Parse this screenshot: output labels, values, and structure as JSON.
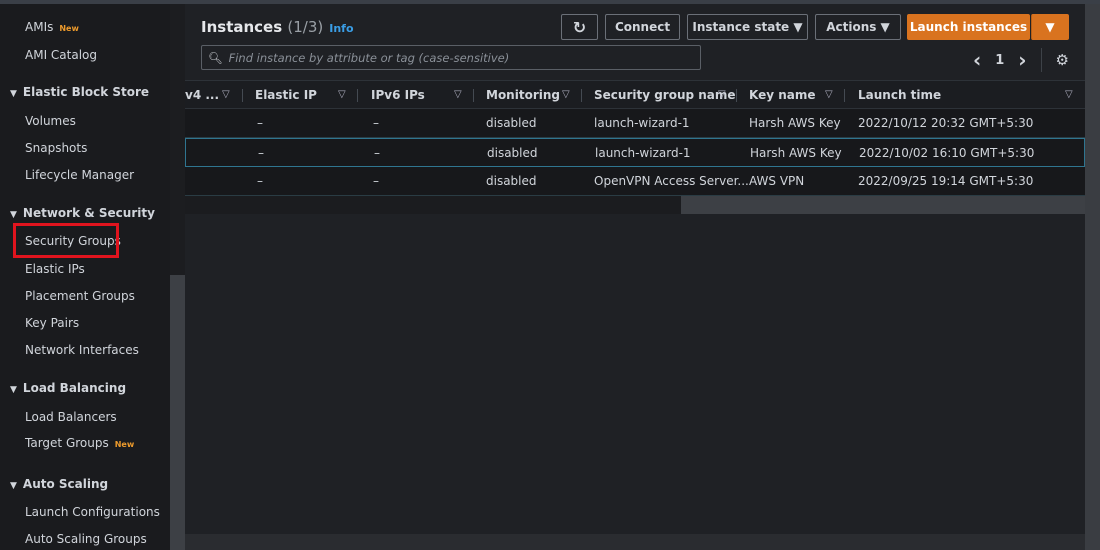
{
  "sidebar": {
    "amis": "AMIs",
    "amis_badge": "New",
    "ami_catalog": "AMI Catalog",
    "ebs": {
      "title": "Elastic Block Store",
      "items": [
        "Volumes",
        "Snapshots",
        "Lifecycle Manager"
      ]
    },
    "netsec": {
      "title": "Network & Security",
      "items": [
        "Security Groups",
        "Elastic IPs",
        "Placement Groups",
        "Key Pairs",
        "Network Interfaces"
      ]
    },
    "lb": {
      "title": "Load Balancing",
      "items": [
        "Load Balancers",
        "Target Groups"
      ],
      "badge": "New"
    },
    "as": {
      "title": "Auto Scaling",
      "items": [
        "Launch Configurations",
        "Auto Scaling Groups"
      ]
    }
  },
  "header": {
    "title": "Instances",
    "count": "(1/3)",
    "info": "Info"
  },
  "toolbar": {
    "refresh": "↻",
    "connect": "Connect",
    "instance_state": "Instance state ▼",
    "actions": "Actions ▼",
    "launch": "Launch instances",
    "launch_dd": "▼"
  },
  "search": {
    "placeholder": "Find instance by attribute or tag (case-sensitive)"
  },
  "pager": {
    "prev": "‹",
    "page": "1",
    "next": "›",
    "settings": "⚙"
  },
  "table": {
    "columns": [
      "v4 ...",
      "Elastic IP",
      "IPv6 IPs",
      "Monitoring",
      "Security group name",
      "Key name",
      "Launch time"
    ],
    "rows": [
      [
        "",
        "–",
        "–",
        "disabled",
        "launch-wizard-1",
        "Harsh AWS Key",
        "2022/10/12 20:32 GMT+5:30"
      ],
      [
        "",
        "–",
        "–",
        "disabled",
        "launch-wizard-1",
        "Harsh AWS Key",
        "2022/10/02 16:10 GMT+5:30"
      ],
      [
        "",
        "–",
        "–",
        "disabled",
        "OpenVPN Access Server...",
        "AWS VPN",
        "2022/09/25 19:14 GMT+5:30"
      ]
    ],
    "filter_icon": "▽"
  },
  "colors": {
    "accent": "#d9731f",
    "highlight": "#e0141e",
    "info": "#3a9ee6"
  }
}
